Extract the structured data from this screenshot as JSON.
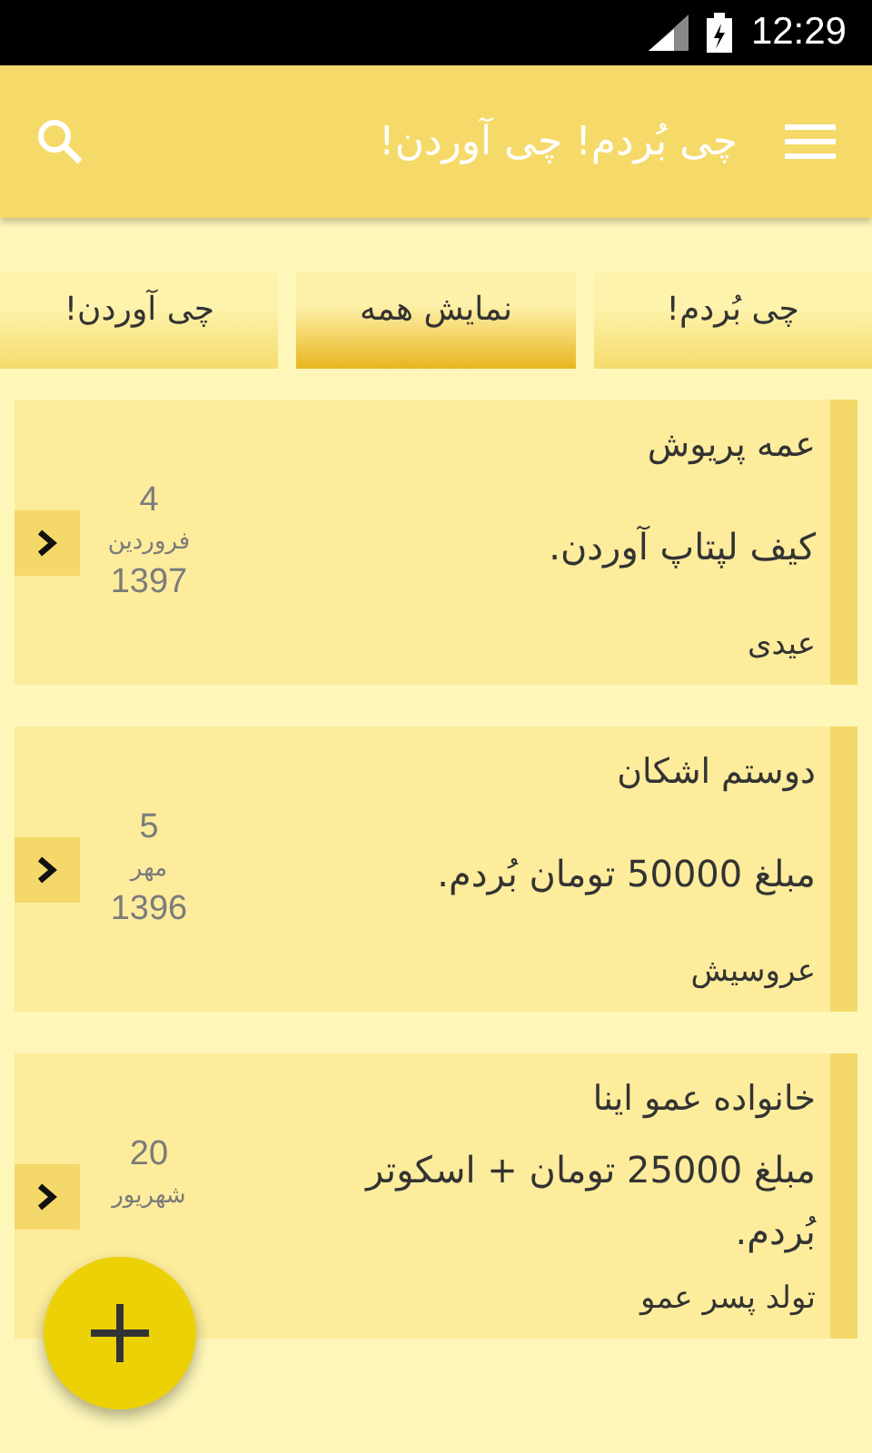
{
  "status_bar": {
    "time": "12:29"
  },
  "app_bar": {
    "title": "چی بُردم! چی آوردن!"
  },
  "tabs": [
    {
      "label": "چی بُردم!",
      "selected": false
    },
    {
      "label": "نمایش همه",
      "selected": true
    },
    {
      "label": "چی آوردن!",
      "selected": false
    }
  ],
  "cards": [
    {
      "name": "عمه پریوش",
      "description": "کیف لپتاپ آوردن.",
      "occasion": "عیدی",
      "day": "4",
      "month": "فروردین",
      "year": "1397"
    },
    {
      "name": "دوستم اشکان",
      "description": "مبلغ 50000 تومان بُردم.",
      "occasion": "عروسیش",
      "day": "5",
      "month": "مهر",
      "year": "1396"
    },
    {
      "name": "خانواده عمو اینا",
      "description": "مبلغ 25000 تومان + اسکوتر بُردم.",
      "occasion": "تولد پسر عمو",
      "day": "20",
      "month": "شهریور"
    }
  ]
}
